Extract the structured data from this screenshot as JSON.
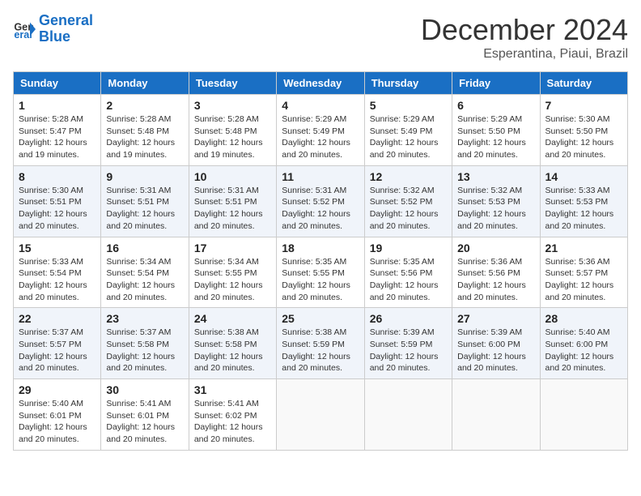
{
  "logo": {
    "line1": "General",
    "line2": "Blue"
  },
  "title": "December 2024",
  "subtitle": "Esperantina, Piaui, Brazil",
  "weekdays": [
    "Sunday",
    "Monday",
    "Tuesday",
    "Wednesday",
    "Thursday",
    "Friday",
    "Saturday"
  ],
  "weeks": [
    [
      {
        "day": "1",
        "info": "Sunrise: 5:28 AM\nSunset: 5:47 PM\nDaylight: 12 hours\nand 19 minutes."
      },
      {
        "day": "2",
        "info": "Sunrise: 5:28 AM\nSunset: 5:48 PM\nDaylight: 12 hours\nand 19 minutes."
      },
      {
        "day": "3",
        "info": "Sunrise: 5:28 AM\nSunset: 5:48 PM\nDaylight: 12 hours\nand 19 minutes."
      },
      {
        "day": "4",
        "info": "Sunrise: 5:29 AM\nSunset: 5:49 PM\nDaylight: 12 hours\nand 20 minutes."
      },
      {
        "day": "5",
        "info": "Sunrise: 5:29 AM\nSunset: 5:49 PM\nDaylight: 12 hours\nand 20 minutes."
      },
      {
        "day": "6",
        "info": "Sunrise: 5:29 AM\nSunset: 5:50 PM\nDaylight: 12 hours\nand 20 minutes."
      },
      {
        "day": "7",
        "info": "Sunrise: 5:30 AM\nSunset: 5:50 PM\nDaylight: 12 hours\nand 20 minutes."
      }
    ],
    [
      {
        "day": "8",
        "info": "Sunrise: 5:30 AM\nSunset: 5:51 PM\nDaylight: 12 hours\nand 20 minutes."
      },
      {
        "day": "9",
        "info": "Sunrise: 5:31 AM\nSunset: 5:51 PM\nDaylight: 12 hours\nand 20 minutes."
      },
      {
        "day": "10",
        "info": "Sunrise: 5:31 AM\nSunset: 5:51 PM\nDaylight: 12 hours\nand 20 minutes."
      },
      {
        "day": "11",
        "info": "Sunrise: 5:31 AM\nSunset: 5:52 PM\nDaylight: 12 hours\nand 20 minutes."
      },
      {
        "day": "12",
        "info": "Sunrise: 5:32 AM\nSunset: 5:52 PM\nDaylight: 12 hours\nand 20 minutes."
      },
      {
        "day": "13",
        "info": "Sunrise: 5:32 AM\nSunset: 5:53 PM\nDaylight: 12 hours\nand 20 minutes."
      },
      {
        "day": "14",
        "info": "Sunrise: 5:33 AM\nSunset: 5:53 PM\nDaylight: 12 hours\nand 20 minutes."
      }
    ],
    [
      {
        "day": "15",
        "info": "Sunrise: 5:33 AM\nSunset: 5:54 PM\nDaylight: 12 hours\nand 20 minutes."
      },
      {
        "day": "16",
        "info": "Sunrise: 5:34 AM\nSunset: 5:54 PM\nDaylight: 12 hours\nand 20 minutes."
      },
      {
        "day": "17",
        "info": "Sunrise: 5:34 AM\nSunset: 5:55 PM\nDaylight: 12 hours\nand 20 minutes."
      },
      {
        "day": "18",
        "info": "Sunrise: 5:35 AM\nSunset: 5:55 PM\nDaylight: 12 hours\nand 20 minutes."
      },
      {
        "day": "19",
        "info": "Sunrise: 5:35 AM\nSunset: 5:56 PM\nDaylight: 12 hours\nand 20 minutes."
      },
      {
        "day": "20",
        "info": "Sunrise: 5:36 AM\nSunset: 5:56 PM\nDaylight: 12 hours\nand 20 minutes."
      },
      {
        "day": "21",
        "info": "Sunrise: 5:36 AM\nSunset: 5:57 PM\nDaylight: 12 hours\nand 20 minutes."
      }
    ],
    [
      {
        "day": "22",
        "info": "Sunrise: 5:37 AM\nSunset: 5:57 PM\nDaylight: 12 hours\nand 20 minutes."
      },
      {
        "day": "23",
        "info": "Sunrise: 5:37 AM\nSunset: 5:58 PM\nDaylight: 12 hours\nand 20 minutes."
      },
      {
        "day": "24",
        "info": "Sunrise: 5:38 AM\nSunset: 5:58 PM\nDaylight: 12 hours\nand 20 minutes."
      },
      {
        "day": "25",
        "info": "Sunrise: 5:38 AM\nSunset: 5:59 PM\nDaylight: 12 hours\nand 20 minutes."
      },
      {
        "day": "26",
        "info": "Sunrise: 5:39 AM\nSunset: 5:59 PM\nDaylight: 12 hours\nand 20 minutes."
      },
      {
        "day": "27",
        "info": "Sunrise: 5:39 AM\nSunset: 6:00 PM\nDaylight: 12 hours\nand 20 minutes."
      },
      {
        "day": "28",
        "info": "Sunrise: 5:40 AM\nSunset: 6:00 PM\nDaylight: 12 hours\nand 20 minutes."
      }
    ],
    [
      {
        "day": "29",
        "info": "Sunrise: 5:40 AM\nSunset: 6:01 PM\nDaylight: 12 hours\nand 20 minutes."
      },
      {
        "day": "30",
        "info": "Sunrise: 5:41 AM\nSunset: 6:01 PM\nDaylight: 12 hours\nand 20 minutes."
      },
      {
        "day": "31",
        "info": "Sunrise: 5:41 AM\nSunset: 6:02 PM\nDaylight: 12 hours\nand 20 minutes."
      },
      null,
      null,
      null,
      null
    ]
  ]
}
